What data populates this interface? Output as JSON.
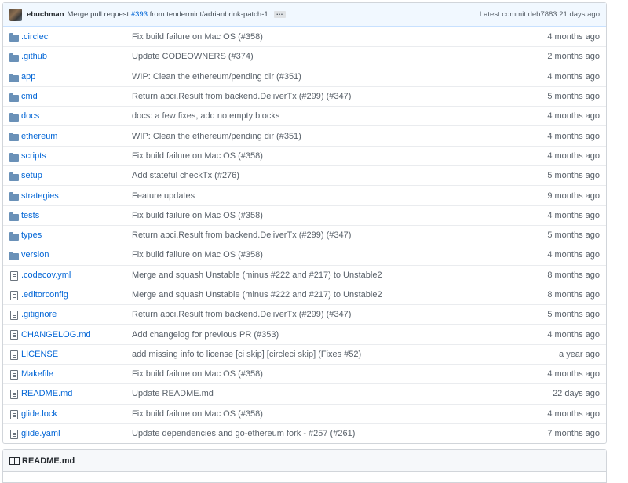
{
  "commit": {
    "author": "ebuchman",
    "message_prefix": "Merge pull request",
    "pr_number": "#393",
    "message_suffix": "from tendermint/adrianbrink-patch-1",
    "ellipsis": "…",
    "latest_label": "Latest commit",
    "sha": "deb7883",
    "age": "21 days ago"
  },
  "files": [
    {
      "type": "dir",
      "name": ".circleci",
      "message": "Fix build failure on Mac OS (#358)",
      "age": "4 months ago"
    },
    {
      "type": "dir",
      "name": ".github",
      "message": "Update CODEOWNERS (#374)",
      "age": "2 months ago"
    },
    {
      "type": "dir",
      "name": "app",
      "message": "WIP: Clean the ethereum/pending dir (#351)",
      "age": "4 months ago"
    },
    {
      "type": "dir",
      "name": "cmd",
      "message": "Return abci.Result from backend.DeliverTx (#299) (#347)",
      "age": "5 months ago"
    },
    {
      "type": "dir",
      "name": "docs",
      "message": "docs: a few fixes, add no empty blocks",
      "age": "4 months ago"
    },
    {
      "type": "dir",
      "name": "ethereum",
      "message": "WIP: Clean the ethereum/pending dir (#351)",
      "age": "4 months ago"
    },
    {
      "type": "dir",
      "name": "scripts",
      "message": "Fix build failure on Mac OS (#358)",
      "age": "4 months ago"
    },
    {
      "type": "dir",
      "name": "setup",
      "message": "Add stateful checkTx (#276)",
      "age": "5 months ago"
    },
    {
      "type": "dir",
      "name": "strategies",
      "message": "Feature updates",
      "age": "9 months ago"
    },
    {
      "type": "dir",
      "name": "tests",
      "message": "Fix build failure on Mac OS (#358)",
      "age": "4 months ago"
    },
    {
      "type": "dir",
      "name": "types",
      "message": "Return abci.Result from backend.DeliverTx (#299) (#347)",
      "age": "5 months ago"
    },
    {
      "type": "dir",
      "name": "version",
      "message": "Fix build failure on Mac OS (#358)",
      "age": "4 months ago"
    },
    {
      "type": "file",
      "name": ".codecov.yml",
      "message": "Merge and squash Unstable (minus #222 and #217) to Unstable2",
      "age": "8 months ago"
    },
    {
      "type": "file",
      "name": ".editorconfig",
      "message": "Merge and squash Unstable (minus #222 and #217) to Unstable2",
      "age": "8 months ago"
    },
    {
      "type": "file",
      "name": ".gitignore",
      "message": "Return abci.Result from backend.DeliverTx (#299) (#347)",
      "age": "5 months ago"
    },
    {
      "type": "file",
      "name": "CHANGELOG.md",
      "message": "Add changelog for previous PR (#353)",
      "age": "4 months ago"
    },
    {
      "type": "file",
      "name": "LICENSE",
      "message": "add missing info to license [ci skip] [circleci skip] (Fixes #52)",
      "age": "a year ago"
    },
    {
      "type": "file",
      "name": "Makefile",
      "message": "Fix build failure on Mac OS (#358)",
      "age": "4 months ago"
    },
    {
      "type": "file",
      "name": "README.md",
      "message": "Update README.md",
      "age": "22 days ago"
    },
    {
      "type": "file",
      "name": "glide.lock",
      "message": "Fix build failure on Mac OS (#358)",
      "age": "4 months ago"
    },
    {
      "type": "file",
      "name": "glide.yaml",
      "message": "Update dependencies and go-ethereum fork - #257 (#261)",
      "age": "7 months ago"
    }
  ],
  "readme": {
    "title": "README.md",
    "icon": "book-icon"
  },
  "icons": {
    "dir": "folder-icon",
    "file": "file-text-icon"
  },
  "colors": {
    "link": "#0366d6",
    "muted": "#586069",
    "folder": "#6a91b8",
    "commit_bar_bg": "#f1f8ff"
  }
}
